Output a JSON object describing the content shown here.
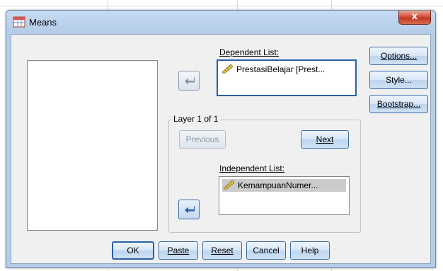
{
  "window": {
    "title": "Means",
    "close_glyph": "x",
    "title_icon": "table-icon"
  },
  "dependent": {
    "label": "Dependent List:",
    "items": [
      "PrestasiBelajar [Prest..."
    ],
    "item_icon": "scale-ruler-icon"
  },
  "layer": {
    "title": "Layer 1 of 1",
    "previous_label": "Previous",
    "next_label": "Next"
  },
  "independent": {
    "label": "Independent List:",
    "items": [
      "KemampuanNumer..."
    ],
    "item_icon": "scale-ruler-icon"
  },
  "side_buttons": {
    "options": "Options...",
    "style": "Style...",
    "bootstrap": "Bootstrap..."
  },
  "bottom_buttons": {
    "ok": "OK",
    "paste": "Paste",
    "reset": "Reset",
    "cancel": "Cancel",
    "help": "Help"
  },
  "colors": {
    "accent_blue": "#2b5fa8",
    "close_red": "#c03a23",
    "window_frame": "#b5cde9"
  }
}
